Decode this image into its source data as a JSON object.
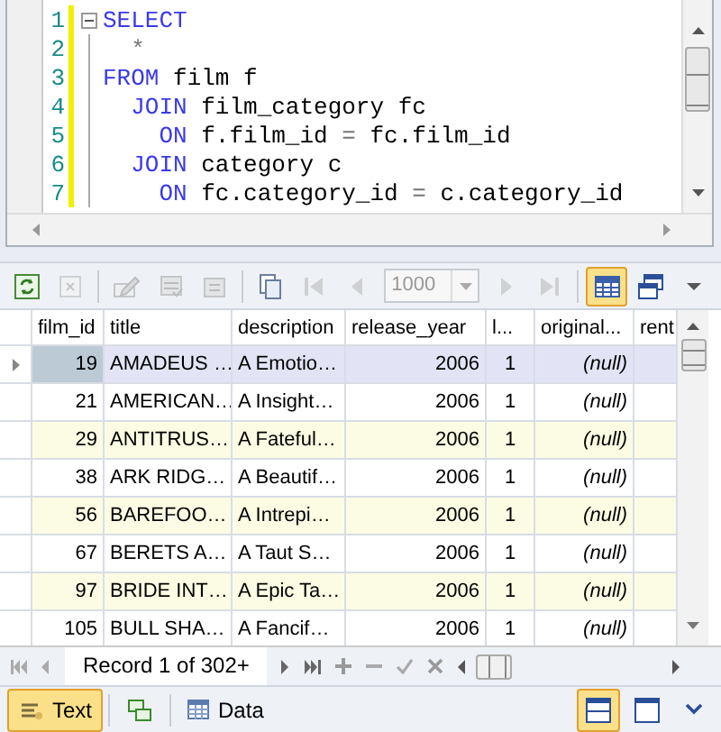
{
  "editor": {
    "lines": [
      {
        "number": "1",
        "foldable": true,
        "tokens": [
          {
            "kind": "keyword",
            "text": "SELECT"
          }
        ]
      },
      {
        "number": "2",
        "foldable": false,
        "tokens": [
          {
            "kind": "operator",
            "text": "  *"
          }
        ]
      },
      {
        "number": "3",
        "foldable": false,
        "tokens": [
          {
            "kind": "keyword",
            "text": "FROM"
          },
          {
            "kind": "ident",
            "text": " film f"
          }
        ]
      },
      {
        "number": "4",
        "foldable": false,
        "tokens": [
          {
            "kind": "keyword",
            "text": "  JOIN"
          },
          {
            "kind": "ident",
            "text": " film_category fc"
          }
        ]
      },
      {
        "number": "5",
        "foldable": false,
        "tokens": [
          {
            "kind": "keyword",
            "text": "    ON"
          },
          {
            "kind": "ident",
            "text": " f.film_id "
          },
          {
            "kind": "operator",
            "text": "="
          },
          {
            "kind": "ident",
            "text": " fc.film_id"
          }
        ]
      },
      {
        "number": "6",
        "foldable": false,
        "tokens": [
          {
            "kind": "keyword",
            "text": "  JOIN"
          },
          {
            "kind": "ident",
            "text": " category c"
          }
        ]
      },
      {
        "number": "7",
        "foldable": false,
        "tokens": [
          {
            "kind": "keyword",
            "text": "    ON"
          },
          {
            "kind": "ident",
            "text": " fc.category_id "
          },
          {
            "kind": "operator",
            "text": "="
          },
          {
            "kind": "ident",
            "text": " c.category_id"
          }
        ]
      }
    ]
  },
  "toolbar": [
    {
      "kind": "refresh",
      "disabled": false,
      "selected": false
    },
    {
      "kind": "cancel",
      "disabled": true,
      "selected": false
    },
    {
      "kind": "separator"
    },
    {
      "kind": "edit",
      "disabled": true,
      "selected": false
    },
    {
      "kind": "apply",
      "disabled": true,
      "selected": false
    },
    {
      "kind": "revert",
      "disabled": true,
      "selected": false
    },
    {
      "kind": "separator"
    },
    {
      "kind": "copy",
      "disabled": false,
      "selected": false
    },
    {
      "kind": "first",
      "disabled": true,
      "selected": false
    },
    {
      "kind": "prev",
      "disabled": true,
      "selected": false
    },
    {
      "kind": "limit",
      "value": "1000",
      "disabled": true
    },
    {
      "kind": "next",
      "disabled": true,
      "selected": false
    },
    {
      "kind": "last",
      "disabled": true,
      "selected": false
    },
    {
      "kind": "separator"
    },
    {
      "kind": "grid",
      "disabled": false,
      "selected": true
    },
    {
      "kind": "form",
      "disabled": false,
      "selected": false
    },
    {
      "kind": "more",
      "disabled": false,
      "selected": false
    }
  ],
  "grid": {
    "columns": [
      "film_id",
      "title",
      "description",
      "release_year",
      "l...",
      "original...",
      "rent"
    ],
    "rows": [
      {
        "selected": true,
        "cells": [
          "19",
          "AMADEUS …",
          "A Emotio…",
          "2006",
          "1",
          "(null)",
          ""
        ]
      },
      {
        "selected": false,
        "cells": [
          "21",
          "AMERICAN…",
          "A Insight…",
          "2006",
          "1",
          "(null)",
          ""
        ]
      },
      {
        "selected": false,
        "cells": [
          "29",
          "ANTITRUS…",
          "A Fateful…",
          "2006",
          "1",
          "(null)",
          ""
        ]
      },
      {
        "selected": false,
        "cells": [
          "38",
          "ARK RIDG…",
          "A Beautif…",
          "2006",
          "1",
          "(null)",
          ""
        ]
      },
      {
        "selected": false,
        "cells": [
          "56",
          "BAREFOO…",
          "A Intrepi…",
          "2006",
          "1",
          "(null)",
          ""
        ]
      },
      {
        "selected": false,
        "cells": [
          "67",
          "BERETS A…",
          "A Taut S…",
          "2006",
          "1",
          "(null)",
          ""
        ]
      },
      {
        "selected": false,
        "cells": [
          "97",
          "BRIDE INT…",
          "A Epic Ta…",
          "2006",
          "1",
          "(null)",
          ""
        ]
      },
      {
        "selected": false,
        "cells": [
          "105",
          "BULL SHA…",
          "A Fancif…",
          "2006",
          "1",
          "(null)",
          ""
        ]
      }
    ]
  },
  "navigator": {
    "record": "Record 1 of 302+"
  },
  "bottom_bar": {
    "buttons": [
      {
        "kind": "text",
        "label": "Text",
        "selected": true
      },
      {
        "kind": "swap",
        "selected": false
      },
      {
        "kind": "data",
        "label": "Data",
        "selected": false
      }
    ],
    "layout_buttons": [
      {
        "kind": "split",
        "selected": true
      },
      {
        "kind": "single",
        "selected": false
      }
    ]
  }
}
